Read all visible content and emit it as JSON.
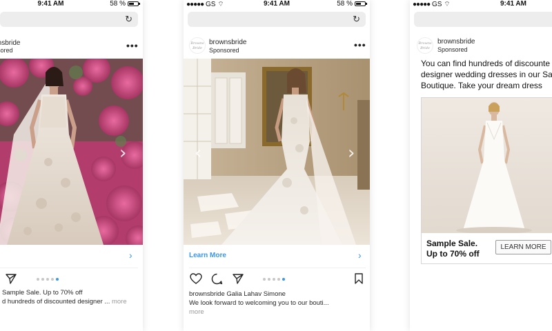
{
  "phones": [
    {
      "status": {
        "time": "9:41 AM",
        "battery": "58 %",
        "battery_level": 0.58
      },
      "post": {
        "username": "brownsbride",
        "sponsored": "Sponsored",
        "more_icon": "ellipsis-icon",
        "nav_icon": "chevron-right-icon",
        "caption_line1": "Sample Sale. Up to 70% off",
        "caption_line2": "d hundreds of discounted designer ...",
        "caption_more": "more",
        "carousel": {
          "count": 5,
          "active": 4
        }
      }
    },
    {
      "status": {
        "carrier": "GS",
        "time": "9:41 AM",
        "battery": "58 %",
        "battery_level": 0.58
      },
      "post": {
        "username": "brownsbride",
        "sponsored": "Sponsored",
        "avatar_text": "Browns Bride",
        "learn_more": "Learn More",
        "caption_line1": "brownsbride Galia Lahav Simone",
        "caption_line2": "We look forward to welcoming you to our bouti...",
        "caption_more": "more",
        "carousel": {
          "count": 5,
          "active": 4
        }
      }
    },
    {
      "status": {
        "carrier": "GS",
        "time": "9:41 AM"
      },
      "post": {
        "username": "brownsbride",
        "sponsored": "Sponsored",
        "avatar_text": "Browns Bride",
        "ad_text": [
          "You can find hundreds of discounte",
          "designer wedding dresses in our Sa",
          "Boutique. Take your dream dress"
        ],
        "sale_line1": "Sample Sale.",
        "sale_line2": "Up to 70% off",
        "cta": "LEARN MORE"
      }
    }
  ],
  "colors": {
    "link_blue": "#3897f0",
    "url_bar": "#ededed"
  }
}
